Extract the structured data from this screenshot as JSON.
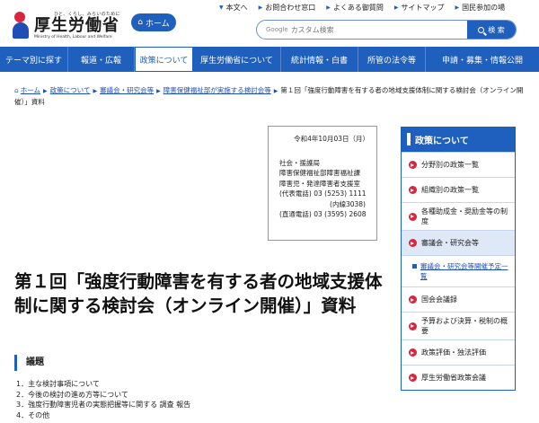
{
  "header": {
    "logo_tagline": "ひと、くらし、みらいのために",
    "logo_main": "厚生労働省",
    "logo_en": "Ministry of Health, Labour and Welfare",
    "home_label": "ホーム",
    "top_links": [
      "本文へ",
      "お問合わせ窓口",
      "よくある御質問",
      "サイトマップ",
      "国民参加の場"
    ],
    "search_brand": "Google",
    "search_placeholder": "カスタム検索",
    "search_button": "検 索"
  },
  "nav": [
    "テーマ別に探す",
    "報道・広報",
    "政策について",
    "厚生労働省について",
    "統計情報・白書",
    "所管の法令等",
    "申請・募集・情報公開"
  ],
  "breadcrumb": {
    "home": "ホーム",
    "items": [
      "政策について",
      "審議会・研究会等",
      "障害保健福祉部が実施する検討会等"
    ],
    "current": "第１回「強度行動障害を有する者の地域支援体制に関する検討会（オンライン開催）」資料"
  },
  "contact": {
    "date": "令和4年10月03日（月）",
    "lines": [
      "社会・援護局",
      "障害保健福祉部障害福祉課",
      "障害児・発達障害者支援室",
      "(代表電話) 03 (5253) 1111"
    ],
    "ext": "(内線3038)",
    "direct": "(直通電話) 03 (3595) 2608"
  },
  "title": "第１回「強度行動障害を有する者の地域支援体制に関する検討会（オンライン開催）」資料",
  "agenda": {
    "heading": "議題",
    "items": [
      "1．主な検討事項について",
      "2．今後の検討の進め方等について",
      "3．強度行動障害児者の実態把握等に関する 調査 報告",
      "4．その他"
    ]
  },
  "sidebar": {
    "heading": "政策について",
    "items": [
      "分野別の政策一覧",
      "組織別の政策一覧",
      "各種助成金・奨励金等の制度",
      "審議会・研究会等"
    ],
    "sub_item": "審議会・研究会等開催予定一覧",
    "items_after": [
      "国会会議録",
      "予算および決算・税制の概要",
      "政策評価・独法評価",
      "厚生労働省政策会議"
    ]
  },
  "colors": {
    "brand_blue": "#1f5fbe",
    "logo_red": "#d7263d"
  }
}
